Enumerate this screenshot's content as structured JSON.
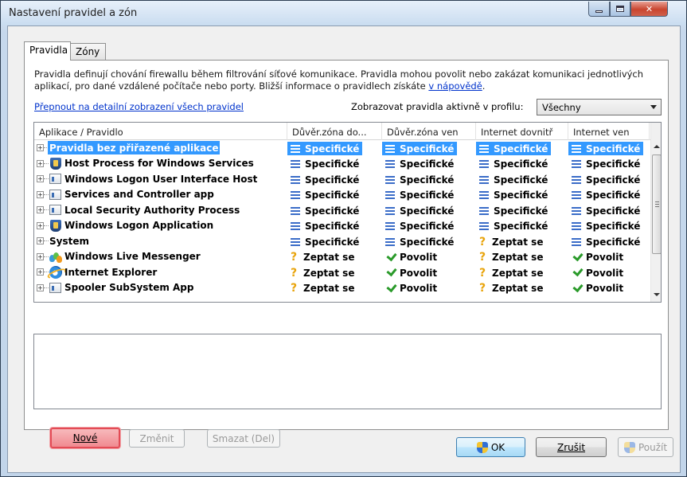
{
  "window": {
    "title": "Nastavení pravidel a zón",
    "controls": {
      "minimize": "minimize-icon",
      "maximize": "maximize-icon",
      "close": "close-icon"
    }
  },
  "tabs": [
    {
      "label": "Pravidla",
      "active": true
    },
    {
      "label": "Zóny",
      "active": false
    }
  ],
  "description": {
    "text": "Pravidla definují chování firewallu během filtrování síťové komunikace. Pravidla mohou povolit nebo zakázat komunikaci jednotlivých aplikací, pro dané vzdálené počítače nebo porty. Bližší informace o pravidlech získáte ",
    "link": "v nápovědě",
    "end": "."
  },
  "detail_link": "Přepnout na detailní zobrazení všech pravidel",
  "profile": {
    "label": "Zobrazovat pravidla aktivně v profilu:",
    "selected": "Všechny"
  },
  "grid": {
    "columns": [
      "Aplikace / Pravidlo",
      "Důvěr.zóna do...",
      "Důvěr.zóna ven",
      "Internet dovnitř",
      "Internet ven"
    ],
    "rows": [
      {
        "name": "Pravidla bez přiřazené aplikace",
        "icon": "none",
        "selected": true,
        "cells": [
          {
            "v": "Specifické",
            "i": "spec"
          },
          {
            "v": "Specifické",
            "i": "spec"
          },
          {
            "v": "Specifické",
            "i": "spec"
          },
          {
            "v": "Specifické",
            "i": "spec"
          }
        ]
      },
      {
        "name": "Host Process for Windows Services",
        "icon": "shield",
        "cells": [
          {
            "v": "Specifické",
            "i": "spec"
          },
          {
            "v": "Specifické",
            "i": "spec"
          },
          {
            "v": "Specifické",
            "i": "spec"
          },
          {
            "v": "Specifické",
            "i": "spec"
          }
        ]
      },
      {
        "name": "Windows Logon User Interface Host",
        "icon": "app",
        "cells": [
          {
            "v": "Specifické",
            "i": "spec"
          },
          {
            "v": "Specifické",
            "i": "spec"
          },
          {
            "v": "Specifické",
            "i": "spec"
          },
          {
            "v": "Specifické",
            "i": "spec"
          }
        ]
      },
      {
        "name": "Services and Controller app",
        "icon": "app",
        "cells": [
          {
            "v": "Specifické",
            "i": "spec"
          },
          {
            "v": "Specifické",
            "i": "spec"
          },
          {
            "v": "Specifické",
            "i": "spec"
          },
          {
            "v": "Specifické",
            "i": "spec"
          }
        ]
      },
      {
        "name": "Local Security Authority Process",
        "icon": "app",
        "cells": [
          {
            "v": "Specifické",
            "i": "spec"
          },
          {
            "v": "Specifické",
            "i": "spec"
          },
          {
            "v": "Specifické",
            "i": "spec"
          },
          {
            "v": "Specifické",
            "i": "spec"
          }
        ]
      },
      {
        "name": "Windows Logon Application",
        "icon": "shield",
        "cells": [
          {
            "v": "Specifické",
            "i": "spec"
          },
          {
            "v": "Specifické",
            "i": "spec"
          },
          {
            "v": "Specifické",
            "i": "spec"
          },
          {
            "v": "Specifické",
            "i": "spec"
          }
        ]
      },
      {
        "name": "System",
        "icon": "none",
        "cells": [
          {
            "v": "Specifické",
            "i": "spec"
          },
          {
            "v": "Specifické",
            "i": "spec"
          },
          {
            "v": "Zeptat se",
            "i": "ask"
          },
          {
            "v": "Specifické",
            "i": "spec"
          }
        ]
      },
      {
        "name": "Windows Live Messenger",
        "icon": "msn",
        "cells": [
          {
            "v": "Zeptat se",
            "i": "ask"
          },
          {
            "v": "Povolit",
            "i": "ok"
          },
          {
            "v": "Zeptat se",
            "i": "ask"
          },
          {
            "v": "Povolit",
            "i": "ok"
          }
        ]
      },
      {
        "name": "Internet Explorer",
        "icon": "ie",
        "cells": [
          {
            "v": "Zeptat se",
            "i": "ask"
          },
          {
            "v": "Povolit",
            "i": "ok"
          },
          {
            "v": "Zeptat se",
            "i": "ask"
          },
          {
            "v": "Povolit",
            "i": "ok"
          }
        ]
      },
      {
        "name": "Spooler SubSystem App",
        "icon": "app",
        "cells": [
          {
            "v": "Zeptat se",
            "i": "ask"
          },
          {
            "v": "Povolit",
            "i": "ok"
          },
          {
            "v": "Zeptat se",
            "i": "ask"
          },
          {
            "v": "Povolit",
            "i": "ok"
          }
        ]
      }
    ]
  },
  "buttons": {
    "new": "Nové",
    "edit": "Změnit",
    "delete": "Smazat (Del)",
    "ok": "OK",
    "cancel": "Zrušit",
    "apply": "Použít"
  },
  "colors": {
    "selection": "#3399ff",
    "specific_icon": "#3b6dc8",
    "ask_icon": "#e8a40c",
    "allow_icon": "#2a9a2a",
    "highlight_button": "#e34b55"
  }
}
